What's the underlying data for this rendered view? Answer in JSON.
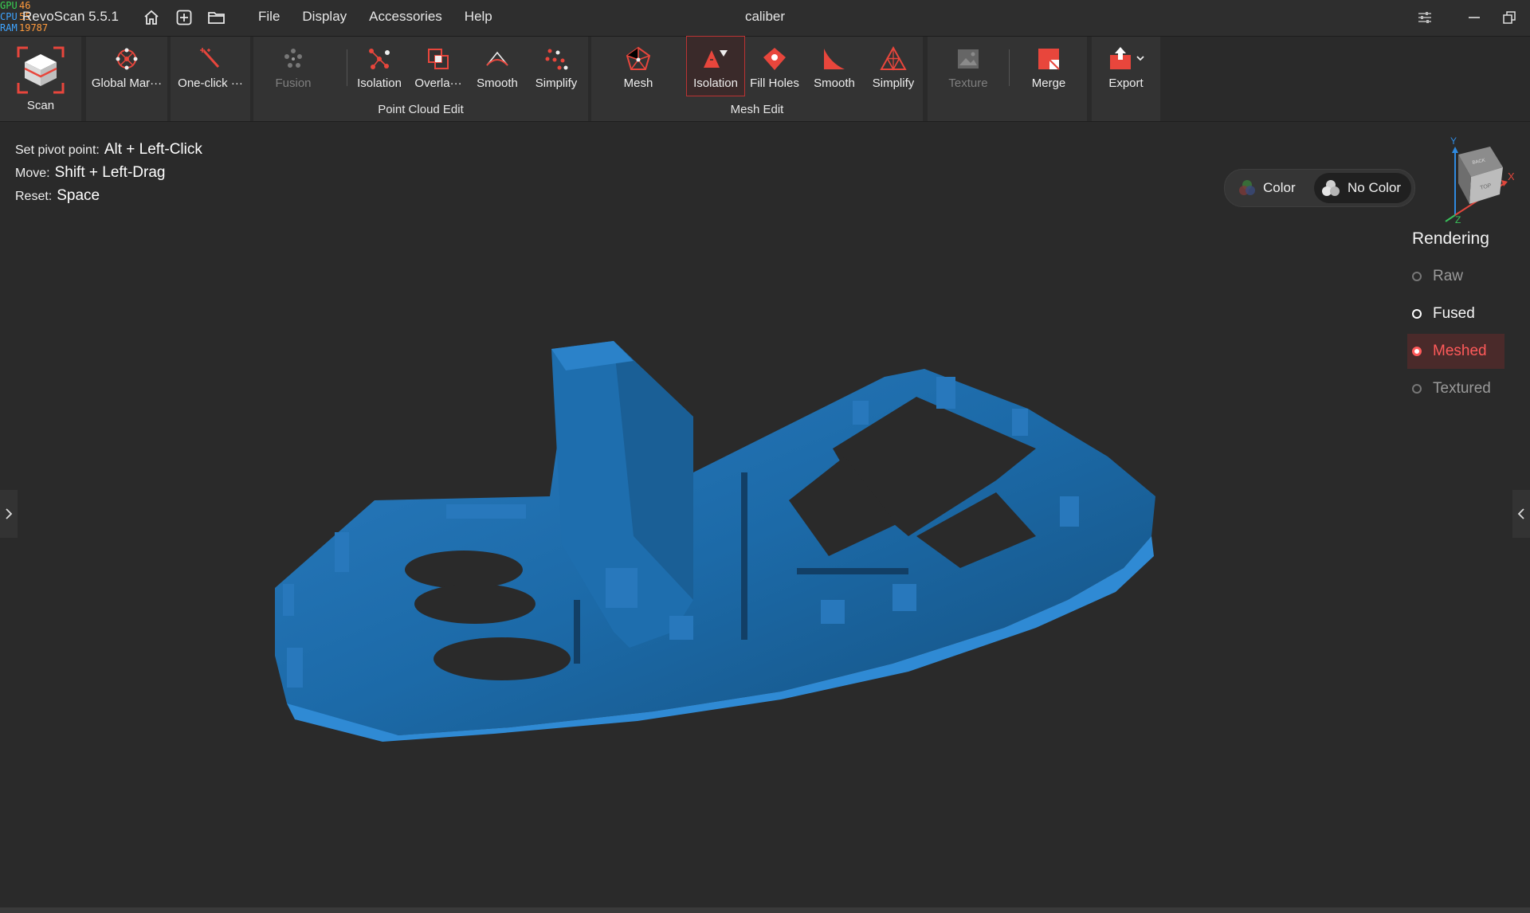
{
  "perf": [
    {
      "key": "GPU",
      "value": "46"
    },
    {
      "key": "CPU",
      "value": "55"
    },
    {
      "key": "RAM",
      "value": "19787"
    }
  ],
  "app_name": "RevoScan 5.5.1",
  "menu": [
    "File",
    "Display",
    "Accessories",
    "Help"
  ],
  "doc_title": "caliber",
  "toolbar": {
    "scan": "Scan",
    "global_markers": "Global Mar···",
    "one_click": "One-click ···",
    "point_cloud": {
      "label": "Point Cloud Edit",
      "tools": [
        "Fusion",
        "Isolation",
        "Overla···",
        "Smooth",
        "Simplify"
      ]
    },
    "mesh_edit": {
      "label": "Mesh Edit",
      "tools": [
        "Mesh",
        "Isolation",
        "Fill Holes",
        "Smooth",
        "Simplify"
      ]
    },
    "texture": "Texture",
    "merge": "Merge",
    "export": "Export"
  },
  "hints": [
    {
      "key": "Set pivot point:",
      "value": "Alt + Left-Click"
    },
    {
      "key": "Move:",
      "value": "Shift + Left-Drag"
    },
    {
      "key": "Reset:",
      "value": "Space"
    }
  ],
  "color_toggle": {
    "color": "Color",
    "no_color": "No Color",
    "selected": "No Color"
  },
  "axes": {
    "x": "X",
    "y": "Y",
    "z": "Z"
  },
  "cube_faces": {
    "top": "TOP",
    "back": "BACK"
  },
  "rendering": {
    "title": "Rendering",
    "options": [
      "Raw",
      "Fused",
      "Meshed",
      "Textured"
    ],
    "selected": "Meshed"
  },
  "colors": {
    "accent": "#e8463c",
    "mesh": "#1d6aa5",
    "background": "#2a2a2a"
  }
}
